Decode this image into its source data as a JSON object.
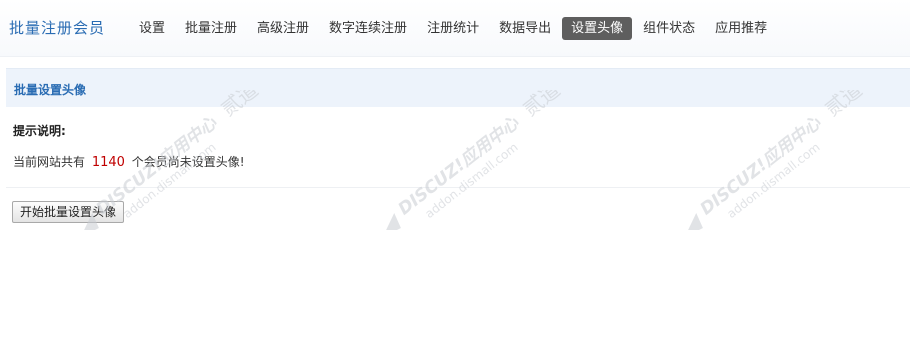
{
  "header": {
    "brand": "批量注册会员",
    "nav": [
      {
        "label": "设置",
        "active": false
      },
      {
        "label": "批量注册",
        "active": false
      },
      {
        "label": "高级注册",
        "active": false
      },
      {
        "label": "数字连续注册",
        "active": false
      },
      {
        "label": "注册统计",
        "active": false
      },
      {
        "label": "数据导出",
        "active": false
      },
      {
        "label": "设置头像",
        "active": true
      },
      {
        "label": "组件状态",
        "active": false
      },
      {
        "label": "应用推荐",
        "active": false
      }
    ]
  },
  "panel": {
    "title": "批量设置头像",
    "tip_title": "提示说明:",
    "tip_prefix": "当前网站共有",
    "member_count": "1140",
    "tip_suffix": "个会员尚未设置头像!",
    "start_button": "开始批量设置头像"
  },
  "watermark": {
    "line1": "DISCUZ!应用中心",
    "line2": "addon.dismall.com",
    "mark": "贰道"
  },
  "colors": {
    "accent": "#2a6cb3",
    "active_tab": "#5e5e5e",
    "count": "#c00000",
    "section_bg": "#edf3fb"
  }
}
